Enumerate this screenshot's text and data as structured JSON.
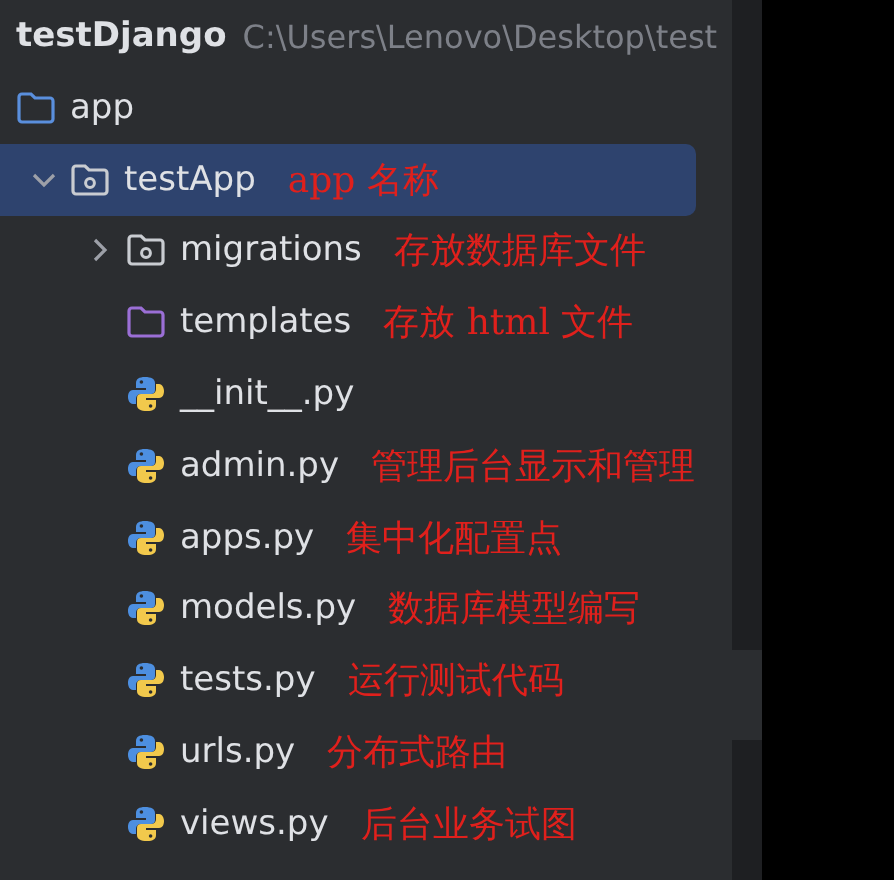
{
  "project": {
    "name": "testDjango",
    "path": "C:\\Users\\Lenovo\\Desktop\\test"
  },
  "tree": [
    {
      "name": "app",
      "kind": "source-folder",
      "selected": false
    },
    {
      "name": "testApp",
      "kind": "package",
      "expanded": true,
      "selected": true,
      "note": "app 名称",
      "children": [
        {
          "name": "migrations",
          "kind": "package",
          "expanded": false,
          "selected": false,
          "note": "存放数据库文件"
        },
        {
          "name": "templates",
          "kind": "template-folder",
          "selected": false,
          "note": "存放 html 文件"
        },
        {
          "name": "__init__.py",
          "kind": "python",
          "selected": false
        },
        {
          "name": "admin.py",
          "kind": "python",
          "selected": false,
          "note": "管理后台显示和管理"
        },
        {
          "name": "apps.py",
          "kind": "python",
          "selected": false,
          "note": "集中化配置点"
        },
        {
          "name": "models.py",
          "kind": "python",
          "selected": false,
          "note": "数据库模型编写"
        },
        {
          "name": "tests.py",
          "kind": "python",
          "selected": false,
          "note": "运行测试代码"
        },
        {
          "name": "urls.py",
          "kind": "python",
          "selected": false,
          "note": "分布式路由"
        },
        {
          "name": "views.py",
          "kind": "python",
          "selected": false,
          "note": "后台业务试图"
        }
      ]
    }
  ]
}
